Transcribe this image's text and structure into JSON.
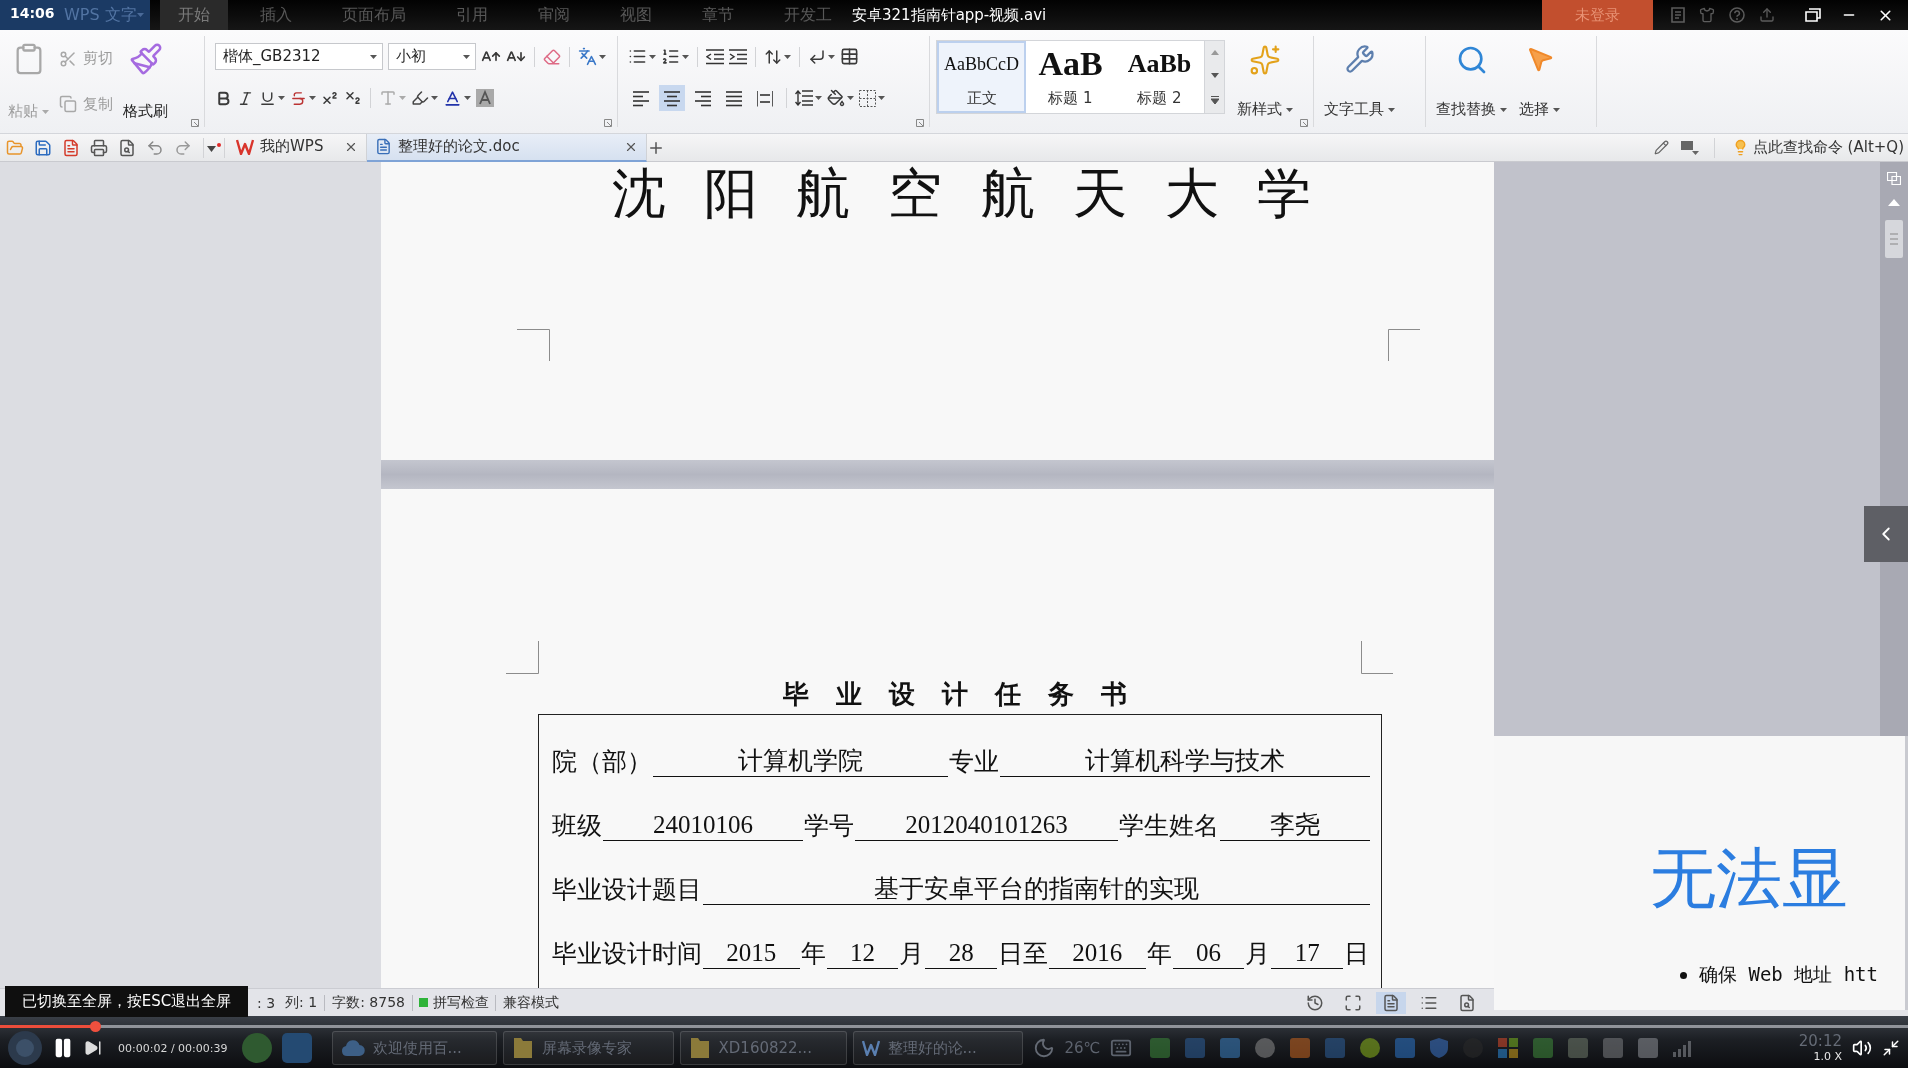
{
  "player": {
    "clock": "14:06",
    "file_title": "安卓321指南针app-视频.avi",
    "toast": "已切换至全屏，按ESC退出全屏",
    "playing": true,
    "progress": {
      "level": 0.05
    },
    "time": "00:00:02 / 00:00:39",
    "speed": "1.0 X"
  },
  "app_bar": {
    "app_name": "WPS 文字",
    "menu_tabs": [
      {
        "label": "开始",
        "selected": true
      },
      {
        "label": "插入",
        "selected": false
      },
      {
        "label": "页面布局",
        "selected": false
      },
      {
        "label": "引用",
        "selected": false
      },
      {
        "label": "审阅",
        "selected": false
      },
      {
        "label": "视图",
        "selected": false
      },
      {
        "label": "章节",
        "selected": false
      },
      {
        "label": "开发工",
        "selected": false
      }
    ],
    "login_button": "未登录"
  },
  "ribbon": {
    "clipboard": [
      {
        "kind": "paste",
        "label": "粘贴",
        "disabled": true
      },
      {
        "kind": "cut",
        "label": "剪切",
        "disabled": true
      },
      {
        "kind": "copy",
        "label": "复制",
        "disabled": true
      },
      {
        "kind": "format_painter",
        "label": "格式刷",
        "disabled": false
      }
    ],
    "font_family": "楷体_GB2312",
    "font_size": "小初",
    "alignment": [
      {
        "kind": "left",
        "selected": false
      },
      {
        "kind": "center",
        "selected": true
      },
      {
        "kind": "right",
        "selected": false
      },
      {
        "kind": "justify",
        "selected": false
      },
      {
        "kind": "distributed",
        "selected": false
      }
    ],
    "styles": [
      {
        "kind": "body",
        "preview": "AaBbCcD",
        "label": "正文",
        "selected": true
      },
      {
        "kind": "heading1",
        "preview": "AaB",
        "label": "标题 1",
        "selected": false
      },
      {
        "kind": "heading2",
        "preview": "AaBb",
        "label": "标题 2",
        "selected": false
      }
    ],
    "tools": [
      {
        "kind": "new_style",
        "label": "新样式"
      },
      {
        "kind": "text_tools",
        "label": "文字工具"
      },
      {
        "kind": "find_replace",
        "label": "查找替换"
      },
      {
        "kind": "select",
        "label": "选择"
      }
    ]
  },
  "quick_bar": {
    "tabs": [
      {
        "kind": "home",
        "label": "我的WPS",
        "selected": false
      },
      {
        "kind": "document",
        "label": "整理好的论文.doc",
        "selected": true
      }
    ],
    "command_search": "点此查找命令 (Alt+Q)"
  },
  "document": {
    "page_1_heading": "沈 阳 航 空 航 天 大 学",
    "form_title": "毕 业 设 计 任 务 书",
    "form_rows": [
      {
        "segments": [
          {
            "kind": "label",
            "text": "院（部）"
          },
          {
            "kind": "field",
            "text": "计算机学院"
          },
          {
            "kind": "label",
            "text": "专业"
          },
          {
            "kind": "field",
            "text": "计算机科学与技术"
          }
        ]
      },
      {
        "segments": [
          {
            "kind": "label",
            "text": "班级"
          },
          {
            "kind": "field",
            "text": "24010106"
          },
          {
            "kind": "label",
            "text": "学号"
          },
          {
            "kind": "field",
            "text": "2012040101263"
          },
          {
            "kind": "label",
            "text": "学生姓名"
          },
          {
            "kind": "field",
            "text": "李尧"
          }
        ]
      },
      {
        "segments": [
          {
            "kind": "label",
            "text": "毕业设计题目"
          },
          {
            "kind": "field",
            "text": "基于安卓平台的指南针的实现"
          }
        ]
      },
      {
        "segments": [
          {
            "kind": "label",
            "text": "毕业设计时间"
          },
          {
            "kind": "field",
            "text": "2015"
          },
          {
            "kind": "label",
            "text": "年"
          },
          {
            "kind": "field",
            "text": "12"
          },
          {
            "kind": "label",
            "text": "月"
          },
          {
            "kind": "field",
            "text": "28"
          },
          {
            "kind": "label",
            "text": "日至"
          },
          {
            "kind": "field",
            "text": "2016"
          },
          {
            "kind": "label",
            "text": "年"
          },
          {
            "kind": "field",
            "text": "06"
          },
          {
            "kind": "label",
            "text": "月"
          },
          {
            "kind": "field",
            "text": "17"
          },
          {
            "kind": "label",
            "text": "日"
          }
        ]
      }
    ]
  },
  "status_bar": {
    "position": ": 3",
    "column": "列: 1",
    "word_count": "字数: 8758",
    "spell_check": {
      "label": "拼写检查",
      "on": true
    },
    "mode": "兼容模式",
    "view_buttons": [
      {
        "kind": "history",
        "selected": false
      },
      {
        "kind": "full_screen",
        "selected": false
      },
      {
        "kind": "page",
        "selected": true
      },
      {
        "kind": "outline",
        "selected": false
      },
      {
        "kind": "web",
        "selected": false
      }
    ]
  },
  "browser_panel": {
    "heading": "无法显",
    "bullets": [
      "确保 Web 地址 htt"
    ]
  },
  "taskbar": {
    "tasks": [
      {
        "kind": "cloud",
        "label": "欢迎使用百..."
      },
      {
        "kind": "folder",
        "label": "屏幕录像专家"
      },
      {
        "kind": "folder",
        "label": "XD160822..."
      },
      {
        "kind": "wps",
        "label": "整理好的论..."
      }
    ],
    "weather": "26℃",
    "clock": "20:12"
  }
}
